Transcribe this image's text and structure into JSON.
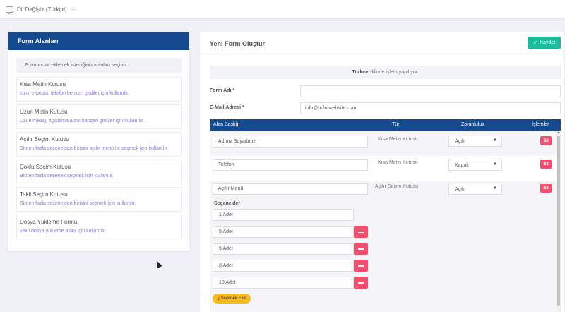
{
  "topbar": {
    "language_label": "Dil Değiştir (Türkçe)"
  },
  "left": {
    "header": "Form Alanları",
    "hint": "Formunuza eklemek istediğiniz alanları seçiniz.",
    "items": [
      {
        "title": "Kısa Metin Kutusu",
        "desc": "İsim, e-posta, telefon benzeri girdiler için kullanılır."
      },
      {
        "title": "Uzun Metin Kutusu",
        "desc": "Uzun mesaj, açıklama alanı benzeri girdiler için kullanılır."
      },
      {
        "title": "Açılır Seçim Kutusu",
        "desc": "Birden fazla seçenekten birisini açılır menü ile seçmek için kullanılır."
      },
      {
        "title": "Çoklu Seçim Kutusu",
        "desc": "Birden fazla seçenek seçmek için kullanılır."
      },
      {
        "title": "Tekli Seçim Kutusu",
        "desc": "Birden fazla seçenekten birisini seçmek için kullanılır."
      },
      {
        "title": "Dosya Yükleme Formu",
        "desc": "Tekli dosya yükleme alanı için kullanılır."
      }
    ]
  },
  "right": {
    "title": "Yeni Form Oluştur",
    "save_label": "Kaydet",
    "lang_info_bold": "Türkçe",
    "lang_info_rest": "dilinde işlem yapılıyor.",
    "form_name_label": "Form Adı *",
    "form_name_value": "",
    "email_label": "E-Mail Adresi *",
    "email_value": "info@bulutwebsite.com",
    "table_headers": [
      "Alan Başlığı",
      "Tür",
      "Zorunluluk",
      "İşlemler"
    ],
    "rows": [
      {
        "title": "Adınız Soyadınız",
        "type": "Kısa Metin Kutusu",
        "required": "Açık",
        "delete": "Sil"
      },
      {
        "title": "Telefon",
        "type": "Kısa Metin Kutusu",
        "required": "Kapalı",
        "delete": "Sil"
      },
      {
        "title": "Açılır Menü",
        "type": "Açılır Seçim Kutusu",
        "required": "Açık",
        "delete": "Sil"
      }
    ],
    "options_label": "Seçenekler",
    "options": [
      "1 Adet",
      "5 Adet",
      "6 Adet",
      "8 Adet",
      "10 Adet"
    ],
    "add_option_label": "Seçenek Ekle"
  }
}
